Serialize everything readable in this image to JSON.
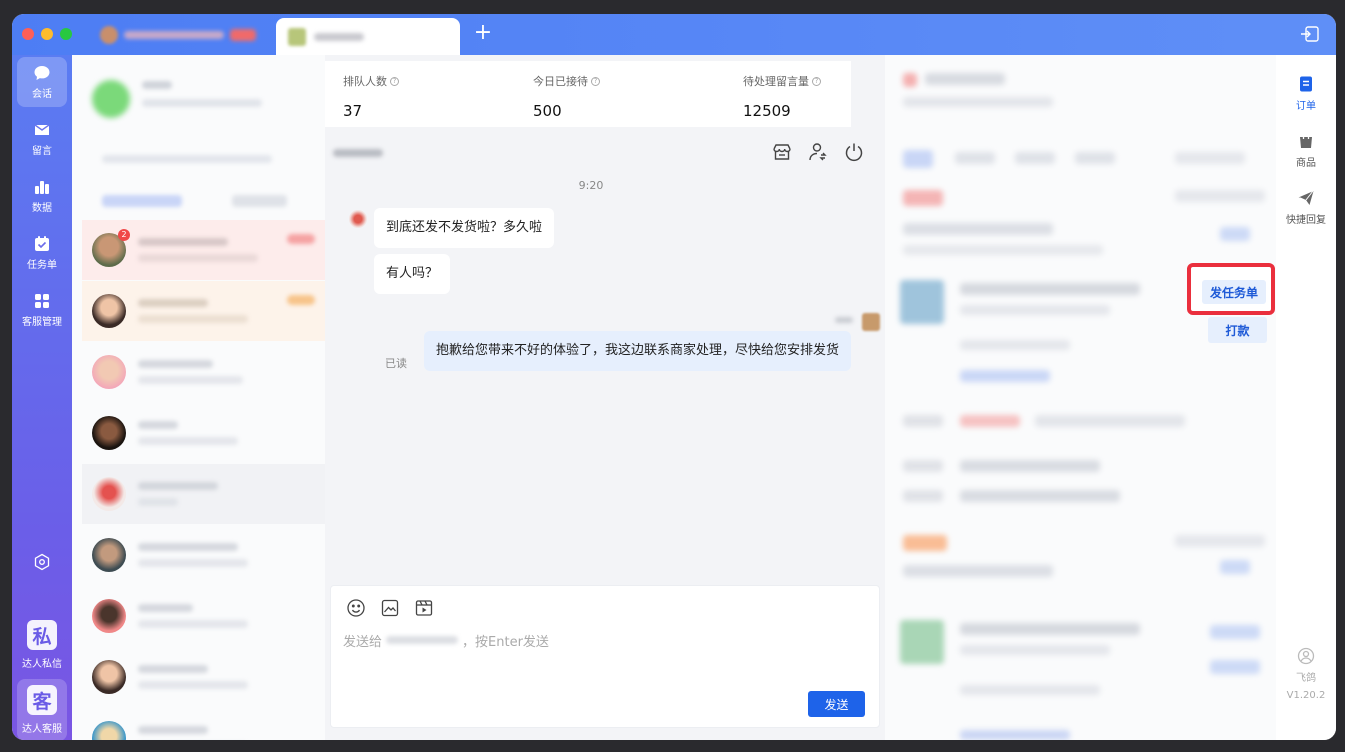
{
  "titlebar": {
    "tab_badge": "",
    "add_tab": "+"
  },
  "rail": {
    "items": [
      {
        "label": "会话",
        "icon": "chat-icon"
      },
      {
        "label": "留言",
        "icon": "mail-icon"
      },
      {
        "label": "数据",
        "icon": "bar-chart-icon"
      },
      {
        "label": "任务单",
        "icon": "task-icon"
      },
      {
        "label": "客服管理",
        "icon": "grid-icon"
      }
    ],
    "settings_icon": "settings-icon",
    "apps": [
      {
        "glyph": "私",
        "label": "达人私信"
      },
      {
        "glyph": "客",
        "label": "达人客服"
      }
    ]
  },
  "conversations": {
    "unread_badge": "2"
  },
  "stats": [
    {
      "label": "排队人数",
      "value": "37"
    },
    {
      "label": "今日已接待",
      "value": "500"
    },
    {
      "label": "待处理留言量",
      "value": "12509"
    }
  ],
  "chat": {
    "time": "9:20",
    "messages": [
      {
        "from": "customer",
        "text": "到底还发不发货啦？多久啦"
      },
      {
        "from": "customer",
        "text": "有人吗？"
      },
      {
        "from": "agent",
        "text": "抱歉给您带来不好的体验了，我这边联系商家处理，尽快给您安排发货"
      }
    ],
    "read_status": "已读",
    "header_icons": [
      "store-icon",
      "transfer-user-icon",
      "power-icon"
    ]
  },
  "composer": {
    "tools": [
      "emoji-icon",
      "image-icon",
      "video-icon"
    ],
    "placeholder_prefix": "发送给",
    "placeholder_suffix": "，按Enter发送",
    "send_label": "发送"
  },
  "orders": {
    "dispatch_task_label": "发任务单",
    "pay_label": "打款"
  },
  "right_toolbar": {
    "items": [
      {
        "label": "订单",
        "icon": "order-icon"
      },
      {
        "label": "商品",
        "icon": "product-icon"
      },
      {
        "label": "快捷回复",
        "icon": "send-icon"
      }
    ],
    "user_label": "飞鸽",
    "version": "V1.20.2"
  },
  "colors": {
    "accent": "#1e63e9",
    "highlight": "#ea2f3d",
    "rail_top": "#5a7cf2",
    "rail_bottom": "#7a55e3"
  }
}
